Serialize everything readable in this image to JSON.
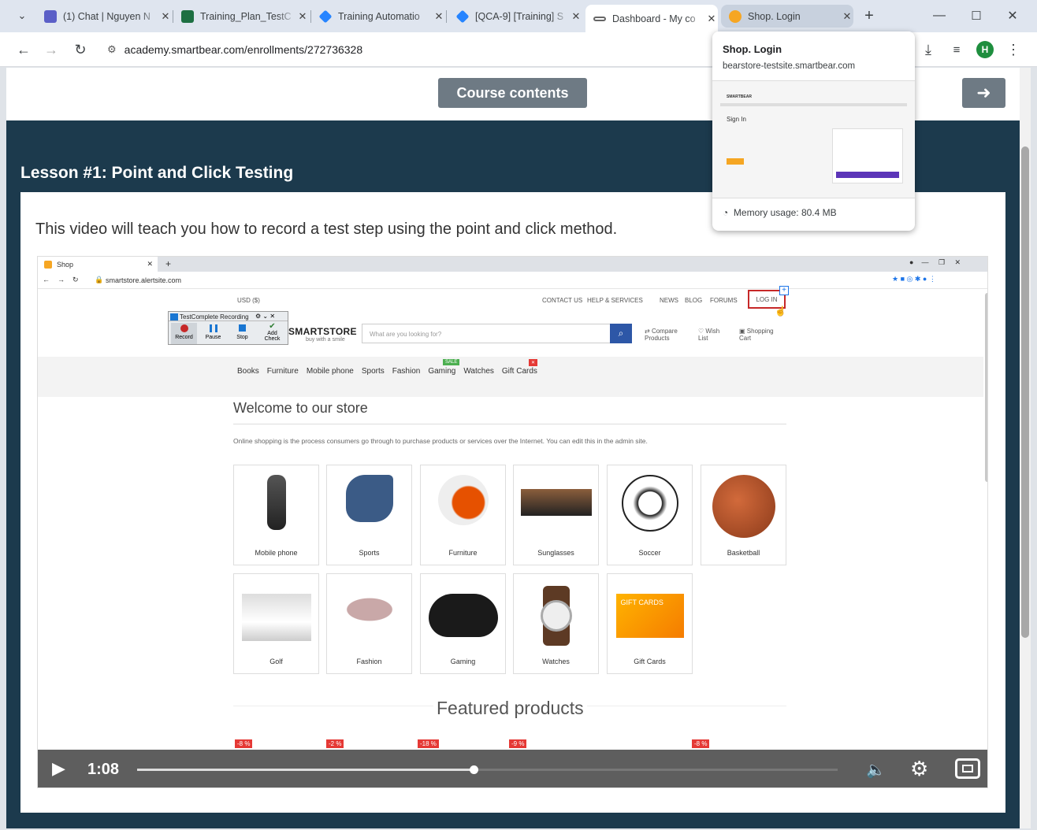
{
  "tabs": [
    {
      "title": "(1) Chat | Nguyen N",
      "icon": "teams-icon"
    },
    {
      "title": "Training_Plan_TestC",
      "icon": "excel-icon"
    },
    {
      "title": "Training Automatio",
      "icon": "jira-icon"
    },
    {
      "title": "[QCA-9] [Training] S",
      "icon": "jira-icon"
    },
    {
      "title": "Dashboard - My co",
      "icon": "smartbear-icon"
    },
    {
      "title": "Shop. Login",
      "icon": "shop-icon"
    }
  ],
  "address": "academy.smartbear.com/enrollments/272736328",
  "profile_initial": "H",
  "page": {
    "course_contents": "Course contents",
    "lesson_title": "Lesson #1: Point and Click Testing",
    "description": "This video will teach you how to record a test step using the point and click method."
  },
  "popup": {
    "title": "Shop. Login",
    "url": "bearstore-testsite.smartbear.com",
    "preview_heading": "Sign In",
    "preview_logo": "SMARTBEAR",
    "memory": "Memory usage: 80.4 MB"
  },
  "video": {
    "tab_title": "Shop",
    "address": "smartstore.alertsite.com",
    "currency": "USD ($)",
    "top_links": [
      "CONTACT US",
      "HELP & SERVICES",
      "NEWS",
      "BLOG",
      "FORUMS"
    ],
    "login": "LOG IN",
    "recorder_title": "TestComplete Recording",
    "recorder_buttons": [
      "Record",
      "Pause",
      "Stop",
      "Add Check"
    ],
    "logo": "SMARTSTORE",
    "logo_tag": "buy with a smile",
    "search_placeholder": "What are you looking for?",
    "compare": "Compare Products",
    "wishlist": "Wish List",
    "cart": "Shopping Cart",
    "nav": [
      "Books",
      "Furniture",
      "Mobile phone",
      "Sports",
      "Fashion",
      "Gaming",
      "Watches",
      "Gift Cards"
    ],
    "sale_badge": "SALE",
    "welcome": "Welcome to our store",
    "intro": "Online shopping is the process consumers go through to purchase products or services over the Internet. You can edit this in the admin site.",
    "categories": [
      "Mobile phone",
      "Sports",
      "Furniture",
      "Sunglasses",
      "Soccer",
      "Basketball",
      "Golf",
      "Fashion",
      "Gaming",
      "Watches",
      "Gift Cards"
    ],
    "gift_card_text": "GIFT CARDS",
    "featured": "Featured products",
    "discounts": [
      "-8 %",
      "-2 %",
      "-18 %",
      "-9 %",
      "-8 %"
    ],
    "time": "1:08",
    "progress": 0.48
  }
}
